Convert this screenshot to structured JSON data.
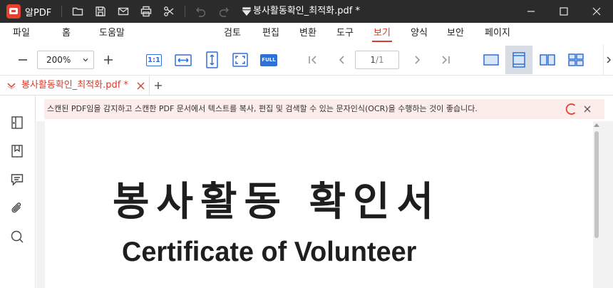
{
  "titlebar": {
    "app_name": "알PDF",
    "document_title": "봉사활동확인_최적화.pdf *",
    "icons": [
      "folder-icon",
      "save-icon",
      "mail-icon",
      "print-icon",
      "scissors-icon",
      "undo-icon",
      "redo-icon",
      "quick-menu-icon"
    ]
  },
  "menu": {
    "items": [
      {
        "label": "파일"
      },
      {
        "label": "홈"
      },
      {
        "label": "도움말"
      },
      {
        "label": "검토"
      },
      {
        "label": "편집"
      },
      {
        "label": "변환"
      },
      {
        "label": "도구"
      },
      {
        "label": "보기"
      },
      {
        "label": "양식"
      },
      {
        "label": "보안"
      },
      {
        "label": "페이지"
      }
    ],
    "active": "보기"
  },
  "toolbar": {
    "zoom_value": "200%",
    "actual_size_label": "1:1",
    "full_label": "FULL",
    "page_current": "1",
    "page_total": "/1"
  },
  "tab": {
    "label": "봉사활동확인_최적화.pdf *"
  },
  "notice": {
    "text": "스캔된 PDF임을 감지하고 스캔한 PDF 문서에서 텍스트를 복사, 편집 및 검색할 수 있는 문자인식(OCR)을 수행하는 것이 좋습니다."
  },
  "document": {
    "title_ko": "봉사활동 확인서",
    "title_en": "Certificate of Volunteer"
  },
  "colors": {
    "titlebar_bg": "#2b2b2b",
    "accent": "#d83b2d",
    "blue": "#2f6fd6",
    "notice_bg": "#fcecea"
  }
}
